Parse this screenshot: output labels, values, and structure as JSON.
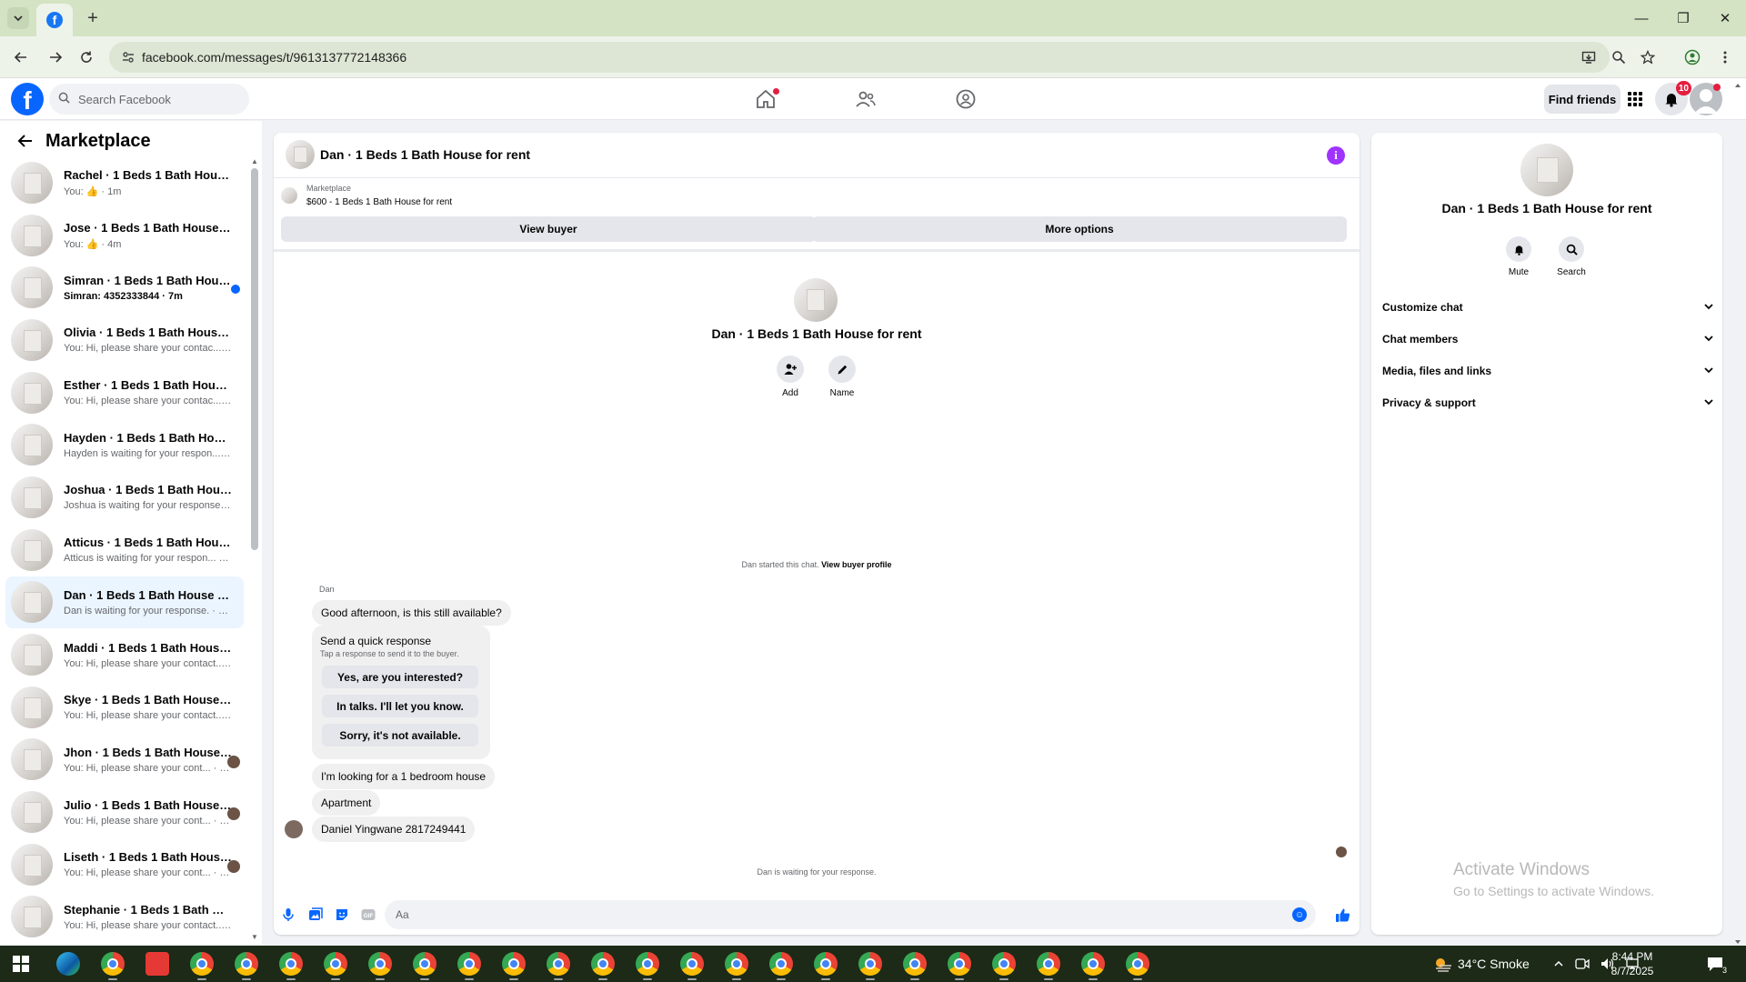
{
  "browser": {
    "url": "facebook.com/messages/t/9613137772148366",
    "new_tab_glyph": "+",
    "window_controls": [
      "—",
      "❐",
      "✕"
    ]
  },
  "facebook": {
    "search_placeholder": "Search Facebook",
    "find_friends": "Find friends",
    "notifications_count": "10"
  },
  "sidebar": {
    "title": "Marketplace",
    "conversations": [
      {
        "name": "Rachel · 1 Beds 1 Bath House for...",
        "sub": "You: 👍 · 1m",
        "unread": false,
        "indicator": "none"
      },
      {
        "name": "Jose · 1 Beds 1 Bath House for r...",
        "sub": "You: 👍 · 4m",
        "unread": false,
        "indicator": "none"
      },
      {
        "name": "Simran · 1 Beds 1 Bath House f...",
        "sub": "Simran: 4352333844 · 7m",
        "unread": true,
        "indicator": "dot"
      },
      {
        "name": "Olivia · 1 Beds 1 Bath House for ...",
        "sub": "You: Hi, please share your contac... · 15m",
        "unread": false,
        "indicator": "none"
      },
      {
        "name": "Esther · 1 Beds 1 Bath House for ...",
        "sub": "You: Hi, please share your contac... · 16m",
        "unread": false,
        "indicator": "none"
      },
      {
        "name": "Hayden · 1 Beds 1 Bath House f...",
        "sub": "Hayden is waiting for your respon... · 4h",
        "unread": false,
        "indicator": "none"
      },
      {
        "name": "Joshua · 1 Beds 1 Bath House fo...",
        "sub": "Joshua is waiting for your response. · 4h",
        "unread": false,
        "indicator": "none"
      },
      {
        "name": "Atticus · 1 Beds 1 Bath House fo...",
        "sub": "Atticus is waiting for your respon... · 12h",
        "unread": false,
        "indicator": "none"
      },
      {
        "name": "Dan · 1 Beds 1 Bath House for re...",
        "sub": "Dan is waiting for your response. · 13h",
        "unread": false,
        "indicator": "none",
        "active": true
      },
      {
        "name": "Maddi · 1 Beds 1 Bath House for...",
        "sub": "You: Hi, please share your contact... · 14h",
        "unread": false,
        "indicator": "none"
      },
      {
        "name": "Skye · 1 Beds 1 Bath House for r...",
        "sub": "You: Hi, please share your contact... · 14h",
        "unread": false,
        "indicator": "none"
      },
      {
        "name": "Jhon · 1 Beds 1 Bath House fo...",
        "sub": "You: Hi, please share your cont... · 14h",
        "unread": false,
        "indicator": "avatar"
      },
      {
        "name": "Julio · 1 Beds 1 Bath House fo...",
        "sub": "You: Hi, please share your cont... · 14h",
        "unread": false,
        "indicator": "avatar"
      },
      {
        "name": "Liseth · 1 Beds 1 Bath House f...",
        "sub": "You: Hi, please share your cont... · 14h",
        "unread": false,
        "indicator": "avatar"
      },
      {
        "name": "Stephanie · 1 Beds 1 Bath House...",
        "sub": "You: Hi, please share your contact... · 14h",
        "unread": false,
        "indicator": "none"
      }
    ]
  },
  "chat": {
    "title": "Dan · 1 Beds 1 Bath House for rent",
    "marketplace_label": "Marketplace",
    "listing": "$600 - 1 Beds 1 Bath House for rent",
    "view_buyer": "View buyer",
    "more_options": "More options",
    "profile_name": "Dan · 1 Beds 1 Bath House for rent",
    "add_label": "Add",
    "name_label": "Name",
    "started_prefix": "Dan started this chat.",
    "view_buyer_profile": "View buyer profile",
    "sender": "Dan",
    "messages": [
      "Good afternoon, is this still available?",
      "I'm looking for a 1 bedroom house",
      "Apartment",
      "Daniel Yingwane 2817249441"
    ],
    "quick_response": {
      "title": "Send a quick response",
      "subtitle": "Tap a response to send it to the buyer.",
      "options": [
        "Yes, are you interested?",
        "In talks. I'll let you know.",
        "Sorry, it's not available."
      ]
    },
    "waiting": "Dan is waiting for your response.",
    "composer_placeholder": "Aa"
  },
  "right_panel": {
    "name": "Dan · 1 Beds 1 Bath House for rent",
    "mute": "Mute",
    "search": "Search",
    "sections": [
      "Customize chat",
      "Chat members",
      "Media, files and links",
      "Privacy & support"
    ]
  },
  "watermark": {
    "line1": "Activate Windows",
    "line2": "Go to Settings to activate Windows."
  },
  "taskbar": {
    "weather": "34°C  Smoke",
    "time": "8:44 PM",
    "date": "8/7/2025",
    "notification_count": "3"
  }
}
